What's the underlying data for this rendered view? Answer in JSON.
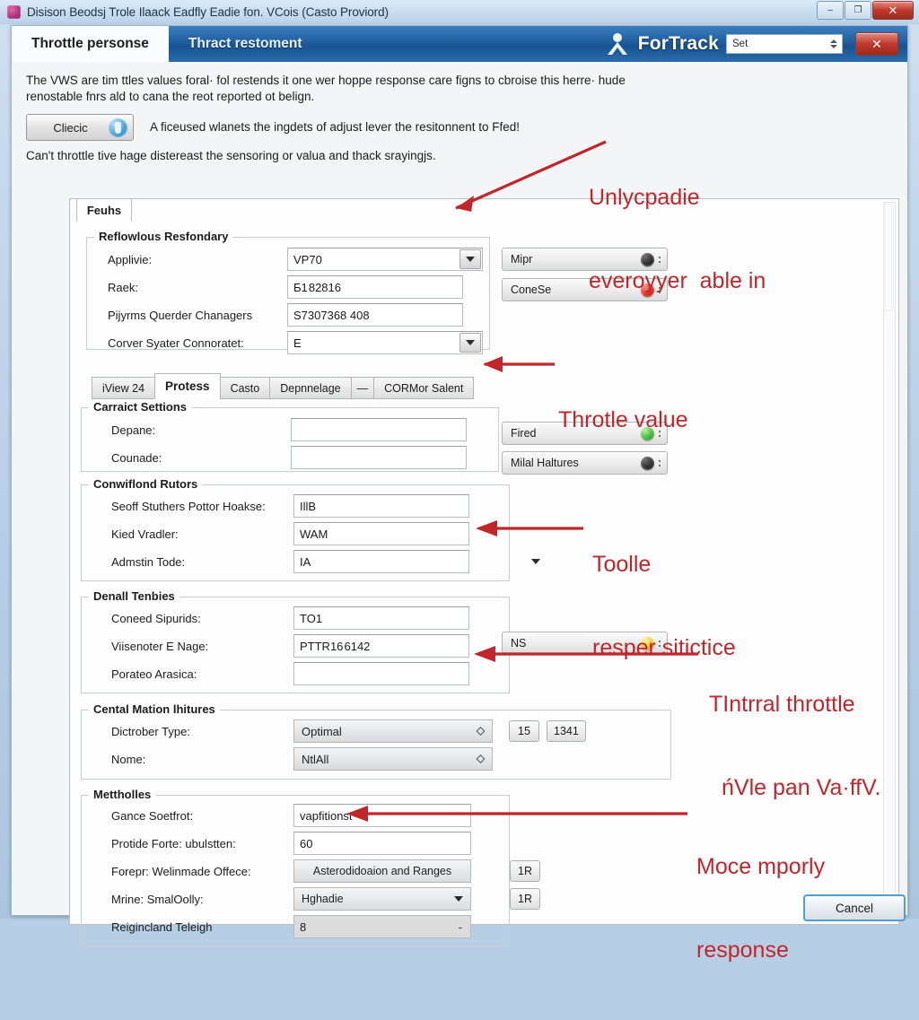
{
  "outer_window": {
    "title": "Disison Beodsj Trole Ilaack Eadfly Eadie fon. VCois (Casto Proviord)",
    "app_icon": "app-icon",
    "buttons": {
      "minimize": "–",
      "maximize": "❐",
      "close": "✕"
    }
  },
  "dialog": {
    "tabs": [
      {
        "label": "Throttle personse",
        "active": true
      },
      {
        "label": "Thract restoment",
        "active": false
      }
    ],
    "brand": "ForTrack",
    "person_icon": "person-icon",
    "header_combo": {
      "value": "Set"
    },
    "close_label": "✕"
  },
  "intro": {
    "line1": "The VWS are tim ttles values foral· fol restends it one wer hoppe response care figns to cbroise this herre· hude",
    "line2": "renostable fnrs ald to cana the reot reported ot belign.",
    "check_button": {
      "label": "Cliecic",
      "icon": "shield-icon"
    },
    "check_text": "A ficeused wlanets the ingdets of adjust lever the resitonnent to Ffed!",
    "line3": "Can't throttle tive hage distereast the sensoring or valuа and thack srayingjs."
  },
  "content": {
    "tab_label": "Feuhs",
    "group_primary": {
      "title": "Reflowlous Resfondary",
      "rows": [
        {
          "label": "Applivie:",
          "value": "VP70",
          "type": "combo"
        },
        {
          "label": "Raek:",
          "value": "Ƃ1 82816",
          "type": "text"
        },
        {
          "label": "Pijyrms Querder Chanagers",
          "value": "S7307368 408",
          "type": "text"
        },
        {
          "label": "Corver Syater Connoratet:",
          "value": "E",
          "type": "combo"
        }
      ]
    },
    "status_top": [
      {
        "label": "Mipr",
        "led": "black"
      },
      {
        "label": "ConeSe",
        "led": "red"
      }
    ],
    "inner_tabs": [
      {
        "label": "iView 24",
        "active": false
      },
      {
        "label": "Protess",
        "active": true
      },
      {
        "label": "Casto",
        "active": false
      },
      {
        "label": "Depnnelage",
        "active": false
      },
      {
        "label": "—",
        "active": false
      },
      {
        "label": "CORMor Salent",
        "active": false
      }
    ],
    "group_carract": {
      "title": "Carraict Settions",
      "rows": [
        {
          "label": "Depane:",
          "value": ""
        },
        {
          "label": "Counade:",
          "value": ""
        }
      ]
    },
    "status_mid": [
      {
        "label": "Fired",
        "led": "green"
      },
      {
        "label": "Milal Haltures",
        "led": "black"
      }
    ],
    "group_conwiflond": {
      "title": "Conwiflond Rutors",
      "rows": [
        {
          "label": "Seoff Stuthers Pottor Hoakse:",
          "value": "IllB",
          "type": "text"
        },
        {
          "label": "Kied Vradler:",
          "value": "WAM",
          "type": "text"
        },
        {
          "label": "Admstin Tode:",
          "value": "IA",
          "type": "combo-flat"
        }
      ]
    },
    "group_denall": {
      "title": "Denall Tenbies",
      "rows": [
        {
          "label": "Coneed Sipurids:",
          "value": "TO1"
        },
        {
          "label": "Viisenoter E Nage:",
          "value": "PTTR16 6142"
        },
        {
          "label": "Porateo Arasica:",
          "value": ""
        }
      ]
    },
    "status_ns": [
      {
        "label": "NS",
        "led": "yellow"
      }
    ],
    "group_cental": {
      "title": "Cental Mation lhitures",
      "rows": [
        {
          "label": "Dictrober Type:",
          "value": "Optimal"
        },
        {
          "label": "Nome:",
          "value": "NtlAll"
        }
      ],
      "side_buttons": [
        "15",
        "1341"
      ]
    },
    "group_mettholles": {
      "title": "Mettholles",
      "rows": [
        {
          "label": "Gance Soetfrot:",
          "value": "vapfitionst",
          "type": "text"
        },
        {
          "label": "Protide Forte: ubulstten:",
          "value": "60",
          "type": "text"
        },
        {
          "label": "Forepr: Welinmade Offece:",
          "value": "Asterodidoaion and Ranges",
          "type": "flat"
        },
        {
          "label": "Mrine: SmalOolly:",
          "value": "Hghadie",
          "type": "combo-flat"
        },
        {
          "label": "Reigincland Teleigh",
          "value": "8",
          "type": "gray"
        }
      ],
      "side_buttons": [
        "1R",
        "1R"
      ]
    },
    "cancel_label": "Cancel"
  },
  "annotations": [
    {
      "id": "anno-1",
      "line1": "Unlycpadie",
      "line2": "everoyyer  able in"
    },
    {
      "id": "anno-2",
      "line1": "Throtle value",
      "line2": ""
    },
    {
      "id": "anno-3",
      "line1": "Toolle",
      "line2": "resper sitictice"
    },
    {
      "id": "anno-4",
      "line1": "TIntrral throttle",
      "line2": "ńVle pan Va·ffV."
    },
    {
      "id": "anno-5",
      "line1": "Moсe mporly",
      "line2": "response"
    }
  ],
  "colors": {
    "annotation_red": "#c0262b",
    "header_blue": "#1f5d9e",
    "close_red": "#c0392b",
    "led_red": "#cf1b10",
    "led_green": "#2faa29",
    "led_yellow": "#ecc316",
    "led_black": "#1a1a1a"
  }
}
